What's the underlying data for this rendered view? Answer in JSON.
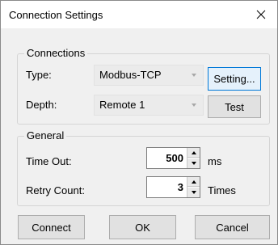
{
  "window": {
    "title": "Connection Settings"
  },
  "connections": {
    "group_label": "Connections",
    "type_label": "Type:",
    "type_value": "Modbus-TCP",
    "setting_button": "Setting...",
    "depth_label": "Depth:",
    "depth_value": "Remote 1",
    "test_button": "Test"
  },
  "general": {
    "group_label": "General",
    "timeout_label": "Time Out:",
    "timeout_value": "500",
    "timeout_unit": "ms",
    "retry_label": "Retry Count:",
    "retry_value": "3",
    "retry_unit": "Times"
  },
  "footer": {
    "connect_button": "Connect",
    "ok_button": "OK",
    "cancel_button": "Cancel"
  },
  "colors": {
    "focus_border": "#0078d7",
    "focus_fill": "#e5f1fb"
  }
}
